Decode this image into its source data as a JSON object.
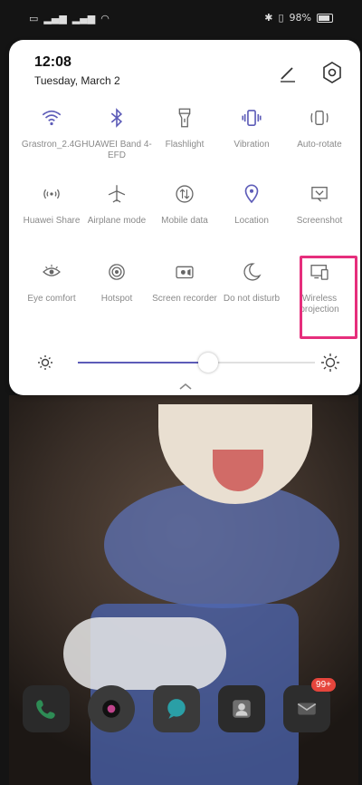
{
  "status_bar": {
    "left_icons": [
      "sim-icon",
      "signal-icon",
      "signal-icon",
      "wifi-icon"
    ],
    "battery_text": "98%",
    "bluetooth_icon": "bluetooth-icon",
    "vibrate_icon": "vibrate-icon"
  },
  "panel": {
    "time": "12:08",
    "date": "Tuesday, March 2",
    "edit_icon": "pencil-icon",
    "settings_icon": "gear-icon",
    "accent": "#5d5cb8",
    "tiles": [
      {
        "label": "Grastron_2.4G",
        "icon": "wifi-icon",
        "active": true
      },
      {
        "label": "HUAWEI Band 4-EFD",
        "icon": "bluetooth-icon",
        "active": true
      },
      {
        "label": "Flashlight",
        "icon": "flashlight-icon",
        "active": false
      },
      {
        "label": "Vibration",
        "icon": "vibrate-icon",
        "active": true
      },
      {
        "label": "Auto-rotate",
        "icon": "rotate-icon",
        "active": false
      },
      {
        "label": "Huawei Share",
        "icon": "share-icon",
        "active": false
      },
      {
        "label": "Airplane mode",
        "icon": "airplane-icon",
        "active": false
      },
      {
        "label": "Mobile data",
        "icon": "mobile-data-icon",
        "active": false
      },
      {
        "label": "Location",
        "icon": "location-icon",
        "active": true
      },
      {
        "label": "Screenshot",
        "icon": "screenshot-icon",
        "active": false
      },
      {
        "label": "Eye comfort",
        "icon": "eye-icon",
        "active": false
      },
      {
        "label": "Hotspot",
        "icon": "hotspot-icon",
        "active": false
      },
      {
        "label": "Screen recorder",
        "icon": "screen-recorder-icon",
        "active": false
      },
      {
        "label": "Do not disturb",
        "icon": "moon-icon",
        "active": false
      },
      {
        "label": "Wireless projection",
        "icon": "projection-icon",
        "active": false
      }
    ],
    "brightness_level": 0.55
  },
  "home": {
    "mail_badge": "99+"
  }
}
